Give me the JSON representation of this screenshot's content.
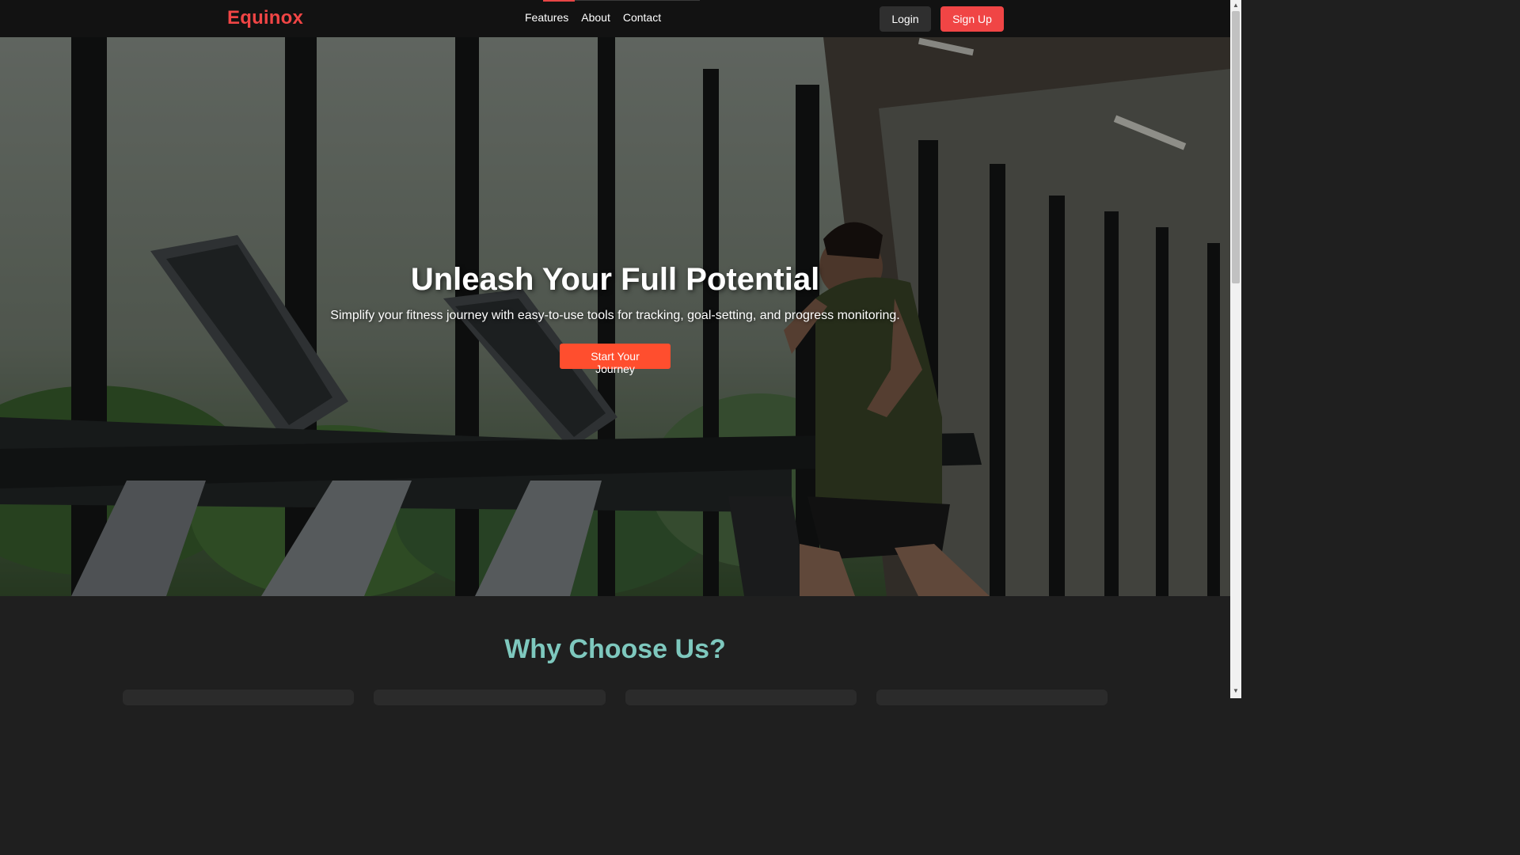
{
  "nav": {
    "logo": "Equinox",
    "links": [
      "Features",
      "About",
      "Contact"
    ],
    "login_label": "Login",
    "signup_label": "Sign Up",
    "accent_color": "#f04545"
  },
  "hero": {
    "title": "Unleash Your Full Potential",
    "subtitle": "Simplify your fitness journey with easy-to-use tools for tracking, goal-setting, and progress monitoring.",
    "cta_label": "Start Your Journey",
    "cta_color": "#ff4e2e",
    "image_subject": "man running on treadmill in gym with large windows"
  },
  "why": {
    "title": "Why Choose Us?",
    "title_color": "#7ec8be"
  }
}
